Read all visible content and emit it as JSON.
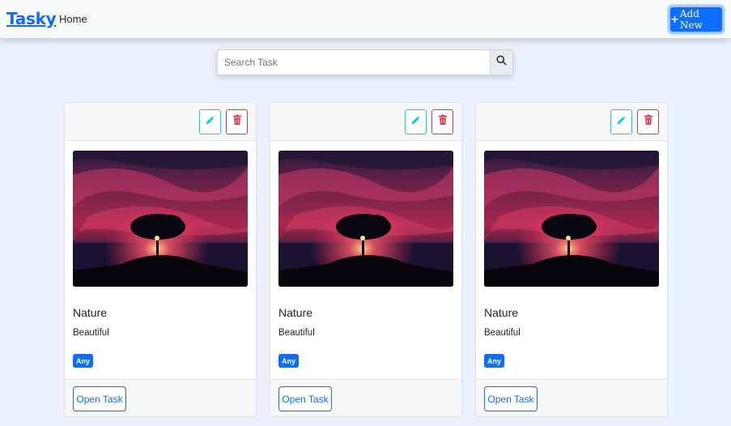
{
  "navbar": {
    "brand": "Tasky",
    "home_link": "Home",
    "add_button_plus": "+",
    "add_button_label": "Add New"
  },
  "search": {
    "placeholder": "Search Task",
    "value": "",
    "icon": "search-icon"
  },
  "cards": [
    {
      "title": "Nature",
      "description": "Beautiful",
      "tag": "Any",
      "open_label": "Open Task",
      "image": "tree-sunset-image"
    },
    {
      "title": "Nature",
      "description": "Beautiful",
      "tag": "Any",
      "open_label": "Open Task",
      "image": "tree-sunset-image"
    },
    {
      "title": "Nature",
      "description": "Beautiful",
      "tag": "Any",
      "open_label": "Open Task",
      "image": "tree-sunset-image"
    }
  ],
  "icons": {
    "edit": "pencil-icon",
    "delete": "trash-icon"
  },
  "colors": {
    "primary": "#0d6efd",
    "info": "#0dcaf0",
    "danger": "#dc3545",
    "page_background": "#eaf1fc"
  }
}
